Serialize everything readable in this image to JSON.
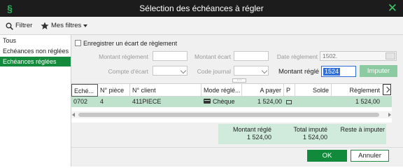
{
  "window": {
    "title": "Sélection des échéances à régler",
    "close_icon": "close-icon"
  },
  "toolbar": {
    "filter_label": "Filtrer",
    "my_filters_label": "Mes filtres"
  },
  "sidebar": {
    "items": [
      {
        "label": "Tous",
        "active": false
      },
      {
        "label": "Echéances non réglées",
        "active": false
      },
      {
        "label": "Echéances réglées",
        "active": true
      }
    ]
  },
  "form": {
    "checkbox_label": "Enregistrer un écart de règlement",
    "montant_reglement_label": "Montant règlement",
    "montant_ecart_label": "Montant écart",
    "date_reglement_label": "Date règlement",
    "date_reglement_value": "1502.",
    "compte_ecart_label": "Compte d'écart",
    "code_journal_label": "Code journal",
    "montant_regle_label": "Montant réglé",
    "montant_regle_value": "1524",
    "imputer_label": "Imputer"
  },
  "grid": {
    "columns": [
      "Eché...",
      "N° pièce",
      "N° client",
      "Mode réglé...",
      "A payer",
      "P",
      "Solde",
      "Règlement"
    ],
    "rows": [
      {
        "echeance": "0702",
        "piece": "4",
        "client": "411PIECE",
        "mode": "Chèque",
        "a_payer": "1 524,00",
        "p": "",
        "solde": "",
        "reglement": "1 524,00"
      }
    ]
  },
  "summary": {
    "montant_regle_label": "Montant réglé",
    "montant_regle_value": "1 524,00",
    "total_impute_label": "Total imputé",
    "total_impute_value": "1 524,00",
    "reste_label": "Reste à imputer",
    "reste_value": ""
  },
  "footer": {
    "ok_label": "OK",
    "cancel_label": "Annuler"
  },
  "colors": {
    "accent": "#118a3c",
    "selected_row": "#bfe2cd",
    "summary_bg": "#d0ebdb",
    "titlebar": "#1c1c1c"
  }
}
